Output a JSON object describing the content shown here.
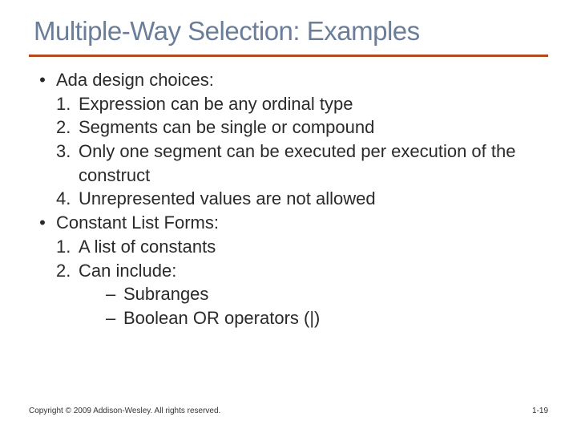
{
  "title": "Multiple-Way Selection: Examples",
  "bullets": [
    {
      "label": "Ada design choices:",
      "items": [
        {
          "n": "1.",
          "t": "Expression can be any ordinal type"
        },
        {
          "n": "2.",
          "t": "Segments can be single or compound"
        },
        {
          "n": "3.",
          "t": "Only one segment can be executed per execution of the construct"
        },
        {
          "n": "4.",
          "t": "Unrepresented values are not allowed"
        }
      ]
    },
    {
      "label": "Constant List Forms:",
      "items": [
        {
          "n": "1.",
          "t": "A list of constants"
        },
        {
          "n": "2.",
          "t": "Can include:",
          "sub": [
            "Subranges",
            "Boolean OR operators (|)"
          ]
        }
      ]
    }
  ],
  "footer": {
    "copyright": "Copyright © 2009 Addison-Wesley. All rights reserved.",
    "page": "1-19"
  },
  "glyphs": {
    "bullet": "•",
    "dash": "–"
  }
}
